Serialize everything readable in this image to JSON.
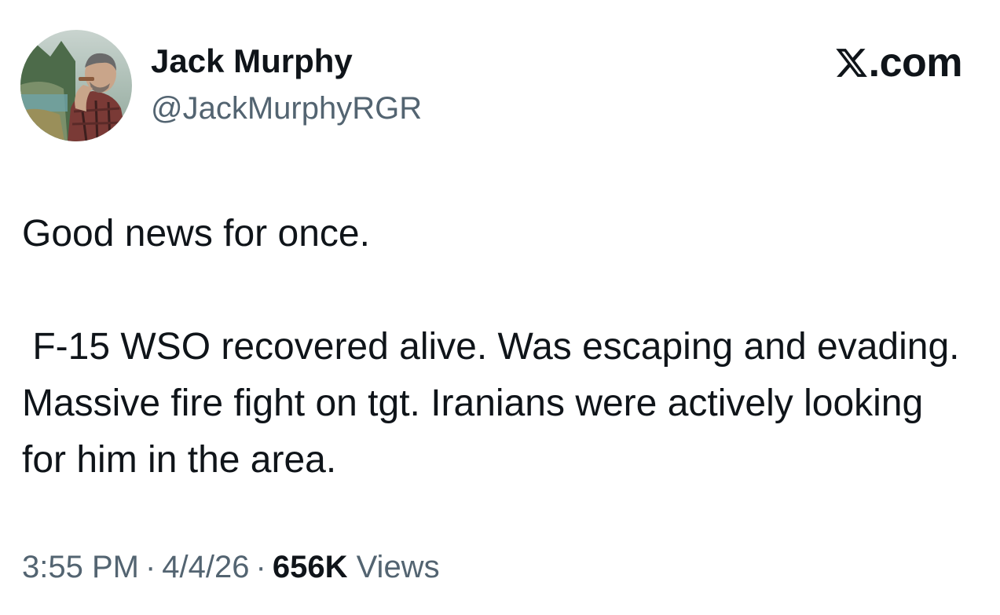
{
  "author": {
    "display_name": "Jack Murphy",
    "handle": "@JackMurphyRGR"
  },
  "brand": {
    "label": ".com",
    "icon": "x-logo-icon"
  },
  "tweet": {
    "paragraphs": [
      "Good news for once.",
      " F-15 WSO recovered alive. Was escaping and evading. Massive fire fight on tgt. Iranians were actively looking for him in the area."
    ]
  },
  "meta": {
    "time": "3:55 PM",
    "separator": "·",
    "date": "4/4/26",
    "views_count": "656K",
    "views_label": "Views"
  }
}
